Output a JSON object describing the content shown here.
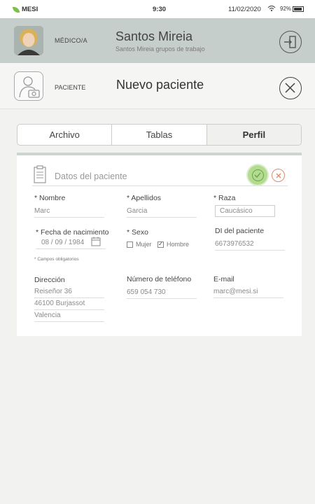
{
  "status_bar": {
    "carrier": "MESI",
    "time": "9:30",
    "date": "11/02/2020",
    "battery": "92%",
    "battery_level": 0.92
  },
  "doctor": {
    "role": "MÉDICO/A",
    "name": "Santos Mireia",
    "subtitle": "Santos Mireia grupos de trabajo"
  },
  "patient_header": {
    "role": "PACIENTE",
    "title": "Nuevo paciente"
  },
  "tabs": [
    {
      "label": "Archivo"
    },
    {
      "label": "Tablas"
    },
    {
      "label": "Perfil"
    }
  ],
  "active_tab": "Perfil",
  "form": {
    "title": "Datos del paciente",
    "nombre": {
      "label": "* Nombre",
      "value": "Marc"
    },
    "apellidos": {
      "label": "* Apellidos",
      "value": "Garcia"
    },
    "raza": {
      "label": "* Raza",
      "value": "Caucásico"
    },
    "fecha": {
      "label": "* Fecha de nacimiento",
      "value": "08 / 09 / 1984"
    },
    "sexo": {
      "label": "* Sexo",
      "option_female": "Mujer",
      "option_male": "Hombre",
      "selected": "Hombre"
    },
    "di": {
      "label": "DI del paciente",
      "value": "6673976532"
    },
    "required_note": "* Campos obligatorios",
    "direccion": {
      "label": "Dirección",
      "line1": "Reiseñor 36",
      "line2": "46100  Burjassot",
      "line3": "Valencia"
    },
    "telefono": {
      "label": "Número de teléfono",
      "value": "659 054 730"
    },
    "email": {
      "label": "E-mail",
      "value": "marc@mesi.si"
    }
  },
  "colors": {
    "doctor_bar": "#c5ceca",
    "save_green": "#b5db92",
    "cancel_orange": "#e08a6a",
    "background": "#f2f2f0"
  }
}
